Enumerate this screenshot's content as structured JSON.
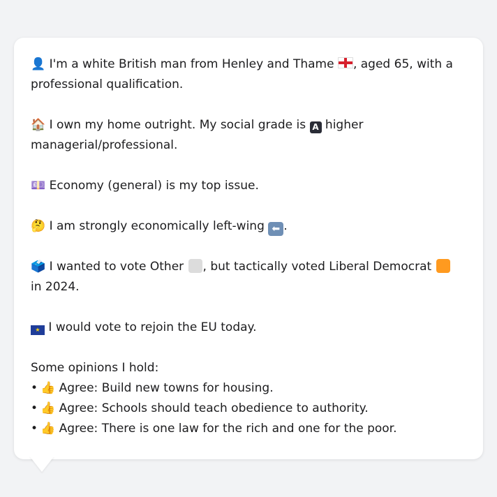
{
  "persona": {
    "line1": {
      "emoji_before": "👤",
      "text_a": " I'm a white British man from Henley and Thame ",
      "text_b": ", aged 65, with a professional qualification."
    },
    "line2": {
      "emoji_before": "🏠",
      "text_a": " I own my home outright. My social grade is ",
      "badge": "A",
      "text_b": " higher managerial/professional."
    },
    "line3": {
      "emoji_before": "💷",
      "text": " Economy (general) is my top issue."
    },
    "line4": {
      "emoji_before": "🤔",
      "text_a": " I am strongly economically left-wing ",
      "arrow": "⬅",
      "text_b": "."
    },
    "line5": {
      "emoji_before": "🗳️",
      "text_a": " I wanted to vote Other ",
      "text_b": ", but tactically voted Liberal Democrat ",
      "text_c": " in 2024."
    },
    "line6": {
      "emoji_before": "🇪🇺",
      "text": " I would vote to rejoin the EU today."
    },
    "opinions_heading": "Some opinions I hold:",
    "opinions": [
      {
        "bullet": "•",
        "emoji": "👍",
        "text": " Agree: Build new towns for housing."
      },
      {
        "bullet": "•",
        "emoji": "👍",
        "text": " Agree: Schools should teach obedience to authority."
      },
      {
        "bullet": "•",
        "emoji": "👍",
        "text": " Agree: There is one law for the rich and one for the poor."
      }
    ]
  },
  "colors": {
    "other_party": "#dcdcdc",
    "libdem": "#ff9a1f",
    "background": "#f2f3f5",
    "card": "#ffffff"
  }
}
